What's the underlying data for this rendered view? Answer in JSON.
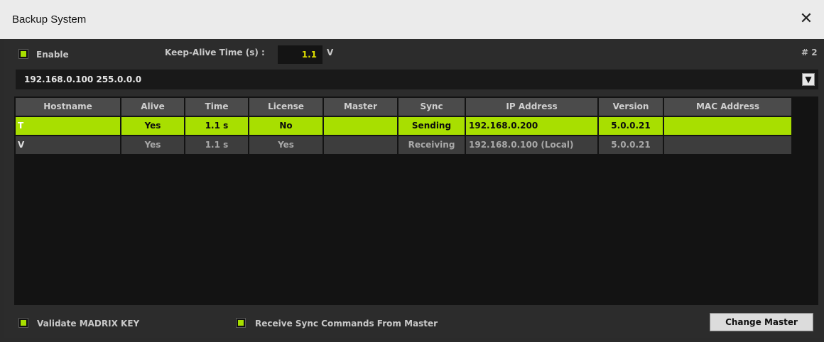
{
  "window": {
    "title": "Backup System",
    "close_glyph": "✕"
  },
  "options": {
    "enable_label": "Enable",
    "enable_checked": true,
    "keep_alive_label": "Keep-Alive Time (s) :",
    "keep_alive_value": "1.1",
    "keep_alive_suffix": "V",
    "instance_label": "# 2"
  },
  "network_select": {
    "selected": "192.168.0.100 255.0.0.0",
    "arrow_icon": "chevron-down-icon"
  },
  "table": {
    "columns": [
      "Hostname",
      "Alive",
      "Time",
      "License",
      "Master",
      "Sync",
      "IP Address",
      "Version",
      "MAC Address"
    ],
    "rows": [
      {
        "hostname": "T",
        "alive": "Yes",
        "time": "1.1 s",
        "license": "No",
        "master": "",
        "sync": "Sending",
        "ip": "192.168.0.200",
        "version": "5.0.0.21",
        "mac": ""
      },
      {
        "hostname": "V",
        "alive": "Yes",
        "time": "1.1 s",
        "license": "Yes",
        "master": "",
        "sync": "Receiving",
        "ip": "192.168.0.100 (Local)",
        "version": "5.0.0.21",
        "mac": ""
      }
    ]
  },
  "footer": {
    "validate_label": "Validate MADRIX KEY",
    "validate_checked": true,
    "receive_sync_label": "Receive Sync Commands From Master",
    "receive_sync_checked": true,
    "change_master_label": "Change Master"
  },
  "colors": {
    "accent": "#A8DF00",
    "header_bg": "#4B4B4B",
    "row_bg": "#3D3D3D",
    "window_bg": "#2C2C2C"
  }
}
